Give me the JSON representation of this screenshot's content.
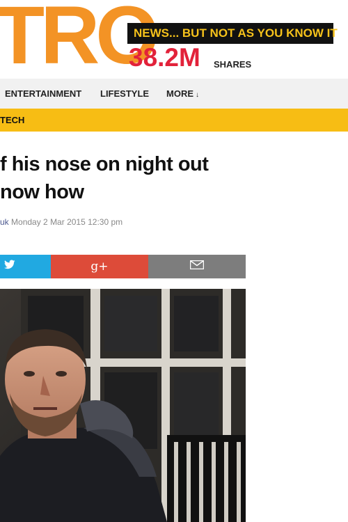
{
  "header": {
    "logo_text": "TRO",
    "tagline": "NEWS... BUT NOT AS YOU KNOW IT",
    "shares_count": "38.2M",
    "shares_label": "SHARES"
  },
  "nav": {
    "items": [
      {
        "label": "ENTERTAINMENT"
      },
      {
        "label": "LIFESTYLE"
      },
      {
        "label": "MORE"
      }
    ]
  },
  "subnav": {
    "label": "TECH"
  },
  "article": {
    "headline_line1": "f his nose on night out",
    "headline_line2": "now how",
    "author": "uk",
    "date": "Monday 2 Mar 2015 12:30 pm"
  },
  "share": {
    "twitter_icon": "twitter-bird-icon",
    "gplus_label": "g+",
    "email_icon": "envelope-icon"
  },
  "colors": {
    "brand_orange": "#f39325",
    "tagline_yellow": "#f6c21b",
    "shares_red": "#e2223a",
    "subnav_yellow": "#f7bd14",
    "twitter_blue": "#21a9e1",
    "gplus_red": "#dd4b39",
    "email_gray": "#7d7d7d"
  }
}
